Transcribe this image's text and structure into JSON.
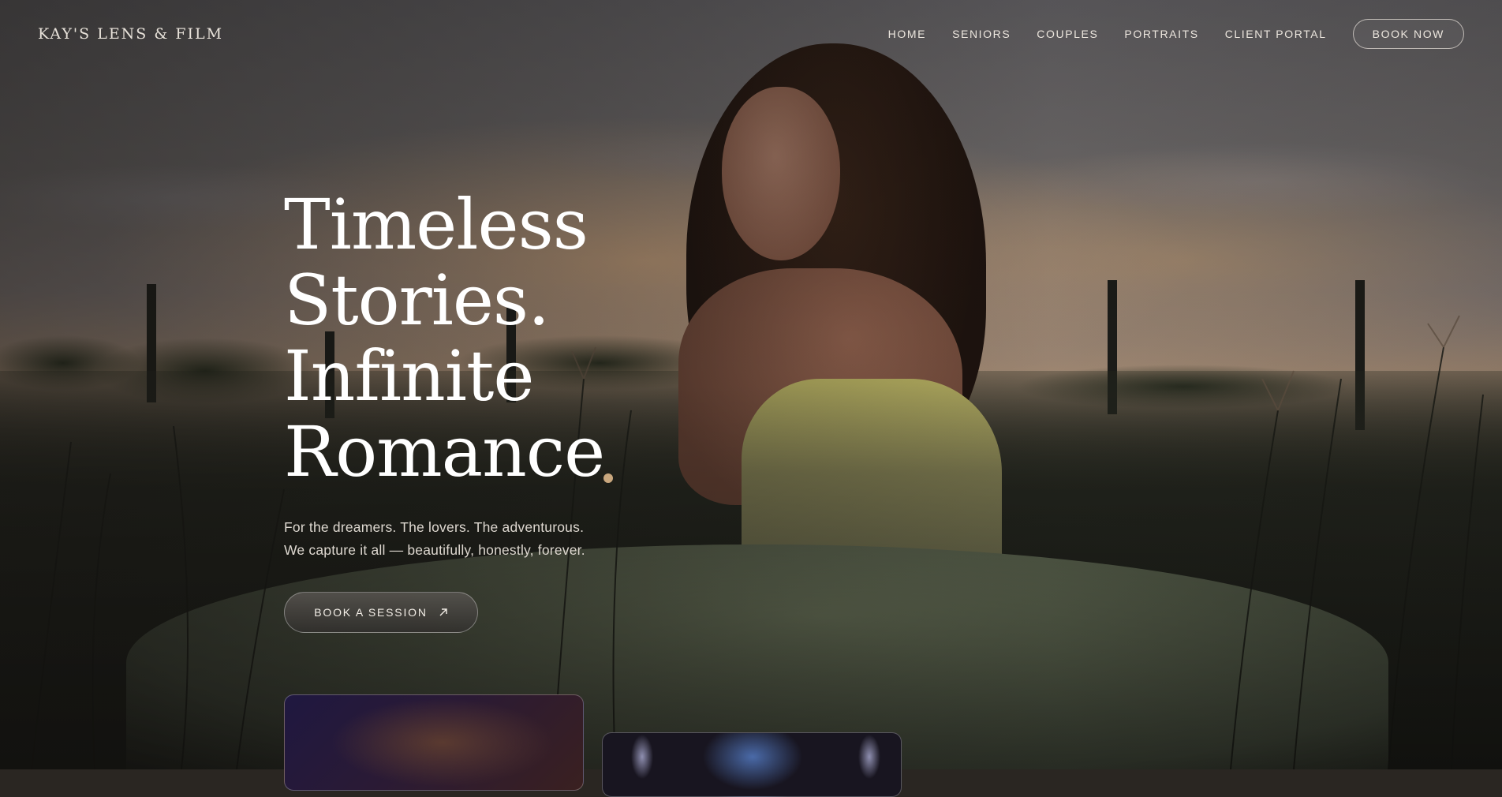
{
  "brand": "KAY'S LENS & FILM",
  "nav": {
    "items": [
      "HOME",
      "SENIORS",
      "COUPLES",
      "PORTRAITS",
      "CLIENT PORTAL"
    ],
    "book_now": "BOOK NOW"
  },
  "hero": {
    "headline": [
      "Timeless",
      "Stories.",
      "Infinite",
      "Romance"
    ],
    "subtext": [
      "For the dreamers. The lovers. The adventurous.",
      "We capture it all — beautifully, honestly, forever."
    ],
    "cta_label": "BOOK A SESSION",
    "cta_icon": "arrow-up-right-icon",
    "accent_color": "#c9a77e"
  }
}
